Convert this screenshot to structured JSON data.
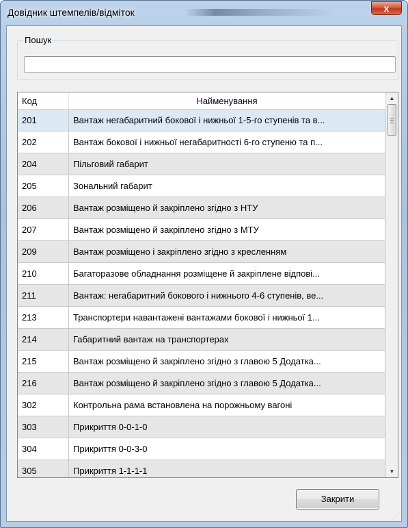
{
  "window": {
    "title": "Довідник штемпелів/відміток",
    "close_glyph": "x"
  },
  "search": {
    "group_label": "Пошук",
    "value": "",
    "placeholder": ""
  },
  "grid": {
    "columns": [
      "Код",
      "Найменування"
    ],
    "selected_index": 0,
    "rows": [
      {
        "code": "201",
        "name": "Вантаж негабаритний бокової і нижньої 1-5-го ступенів та в..."
      },
      {
        "code": "202",
        "name": "Вантаж бокової і нижньої негабаритності 6-го ступеню та п..."
      },
      {
        "code": "204",
        "name": "Пільговий габарит"
      },
      {
        "code": "205",
        "name": "Зональний габарит"
      },
      {
        "code": "206",
        "name": "Вантаж розміщено й закріплено  згідно з НТУ"
      },
      {
        "code": "207",
        "name": "Вантаж розміщено й закріплено  згідно з МТУ"
      },
      {
        "code": "209",
        "name": "Вантаж розміщено і закріплено згідно з  кресленням"
      },
      {
        "code": "210",
        "name": "Багаторазове обладнання розміщене й закріплене  відпові..."
      },
      {
        "code": "211",
        "name": "Вантаж: негабаритний бокового і нижнього 4-6 ступенів, ве..."
      },
      {
        "code": "213",
        "name": "Транспортери навантажені  вантажами бокової і нижньої 1..."
      },
      {
        "code": "214",
        "name": "Габаритний вантаж на транспортерах"
      },
      {
        "code": "215",
        "name": "Вантаж розміщено й закріплено згідно з главою 5 Додатка..."
      },
      {
        "code": "216",
        "name": "Вантаж розміщено й закріплено згідно з главою 5 Додатка..."
      },
      {
        "code": "302",
        "name": "Контрольна рама встановлена на порожньому вагоні"
      },
      {
        "code": "303",
        "name": "Прикриття 0-0-1-0"
      },
      {
        "code": "304",
        "name": "Прикриття 0-0-3-0"
      },
      {
        "code": "305",
        "name": "Прикриття 1-1-1-1"
      }
    ]
  },
  "scrollbar": {
    "up_glyph": "▲",
    "down_glyph": "▼"
  },
  "footer": {
    "close_label": "Закрити",
    "resize_grip": "⋰"
  }
}
